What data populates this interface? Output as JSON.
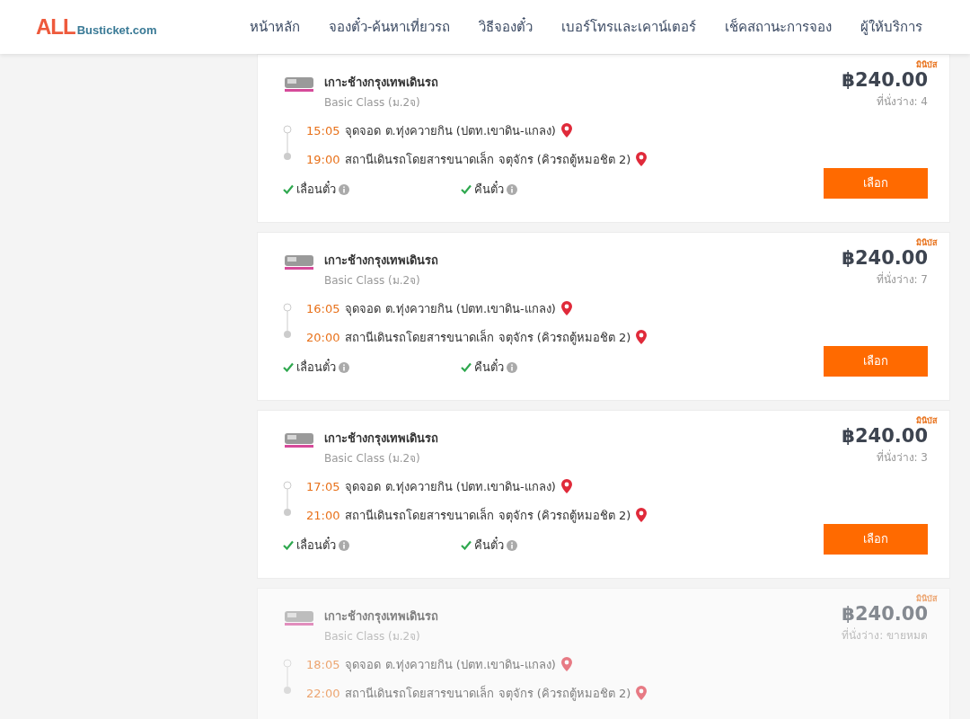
{
  "logo": {
    "mark": "ALL",
    "text": "Busticket.com"
  },
  "nav": [
    {
      "label": "หน้าหลัก"
    },
    {
      "label": "จองตั๋ว-ค้นหาเที่ยวรถ"
    },
    {
      "label": "วิธีจองตั๋ว"
    },
    {
      "label": "เบอร์โทรและเคาน์เตอร์"
    },
    {
      "label": "เช็คสถานะการจอง"
    },
    {
      "label": "ผู้ให้บริการ"
    }
  ],
  "trips": [
    {
      "badge": "มินิบัส",
      "operator": "เกาะช้างกรุงเทพเดินรถ",
      "class": "Basic Class (ม.2จ)",
      "depart_time": "15:05",
      "depart_place": "จุดจอด ต.ทุ่งควายกิน (ปตท.เขาดิน-แกลง)",
      "arrive_time": "19:00",
      "arrive_place": "สถานีเดินรถโดยสารขนาดเล็ก จตุจักร (คิวรถตู้หมอชิต 2)",
      "features": [
        {
          "label": "เลื่อนตั๋ว",
          "checked": true
        },
        {
          "label": "คืนตั๋ว",
          "checked": true
        }
      ],
      "price": "฿240.00",
      "seats": "ที่นั่งว่าง: 4",
      "button": "เลือก",
      "sold_out": false
    },
    {
      "badge": "มินิบัส",
      "operator": "เกาะช้างกรุงเทพเดินรถ",
      "class": "Basic Class (ม.2จ)",
      "depart_time": "16:05",
      "depart_place": "จุดจอด ต.ทุ่งควายกิน (ปตท.เขาดิน-แกลง)",
      "arrive_time": "20:00",
      "arrive_place": "สถานีเดินรถโดยสารขนาดเล็ก จตุจักร (คิวรถตู้หมอชิต 2)",
      "features": [
        {
          "label": "เลื่อนตั๋ว",
          "checked": true
        },
        {
          "label": "คืนตั๋ว",
          "checked": true
        }
      ],
      "price": "฿240.00",
      "seats": "ที่นั่งว่าง: 7",
      "button": "เลือก",
      "sold_out": false
    },
    {
      "badge": "มินิบัส",
      "operator": "เกาะช้างกรุงเทพเดินรถ",
      "class": "Basic Class (ม.2จ)",
      "depart_time": "17:05",
      "depart_place": "จุดจอด ต.ทุ่งควายกิน (ปตท.เขาดิน-แกลง)",
      "arrive_time": "21:00",
      "arrive_place": "สถานีเดินรถโดยสารขนาดเล็ก จตุจักร (คิวรถตู้หมอชิต 2)",
      "features": [
        {
          "label": "เลื่อนตั๋ว",
          "checked": true
        },
        {
          "label": "คืนตั๋ว",
          "checked": true
        }
      ],
      "price": "฿240.00",
      "seats": "ที่นั่งว่าง: 3",
      "button": "เลือก",
      "sold_out": false
    },
    {
      "badge": "มินิบัส",
      "operator": "เกาะช้างกรุงเทพเดินรถ",
      "class": "Basic Class (ม.2จ)",
      "depart_time": "18:05",
      "depart_place": "จุดจอด ต.ทุ่งควายกิน (ปตท.เขาดิน-แกลง)",
      "arrive_time": "22:00",
      "arrive_place": "สถานีเดินรถโดยสารขนาดเล็ก จตุจักร (คิวรถตู้หมอชิต 2)",
      "price": "฿240.00",
      "seats": "ที่นั่งว่าง: ขายหมด",
      "sold_out": true
    }
  ]
}
